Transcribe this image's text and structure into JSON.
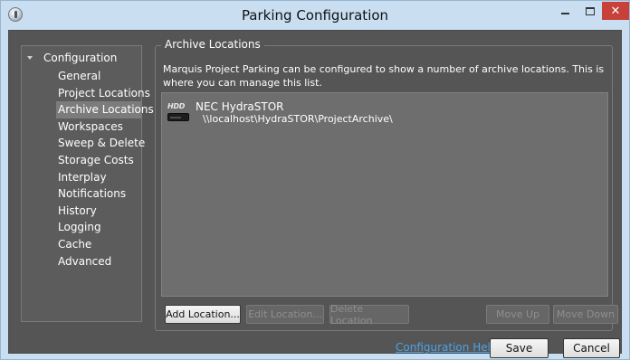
{
  "window": {
    "title": "Parking Configuration",
    "close_glyph": "✕"
  },
  "sidebar": {
    "root_label": "Configuration",
    "items": [
      {
        "label": "General"
      },
      {
        "label": "Project Locations"
      },
      {
        "label": "Archive Locations",
        "selected": true
      },
      {
        "label": "Workspaces"
      },
      {
        "label": "Sweep & Delete"
      },
      {
        "label": "Storage Costs"
      },
      {
        "label": "Interplay"
      },
      {
        "label": "Notifications"
      },
      {
        "label": "History"
      },
      {
        "label": "Logging"
      },
      {
        "label": "Cache"
      },
      {
        "label": "Advanced"
      }
    ]
  },
  "archive": {
    "legend": "Archive Locations",
    "description": "Marquis Project Parking can be configured to show a number of archive locations. This is where you can manage this list.",
    "locations": [
      {
        "icon_text": "HDD",
        "name": "NEC HydraSTOR",
        "path": "\\\\localhost\\HydraSTOR\\ProjectArchive\\"
      }
    ],
    "buttons": {
      "add": "Add Location...",
      "edit": "Edit Location...",
      "delete": "Delete Location",
      "move_up": "Move Up",
      "move_down": "Move Down"
    }
  },
  "footer": {
    "help_link": "Configuration Help",
    "save": "Save",
    "cancel": "Cancel"
  }
}
